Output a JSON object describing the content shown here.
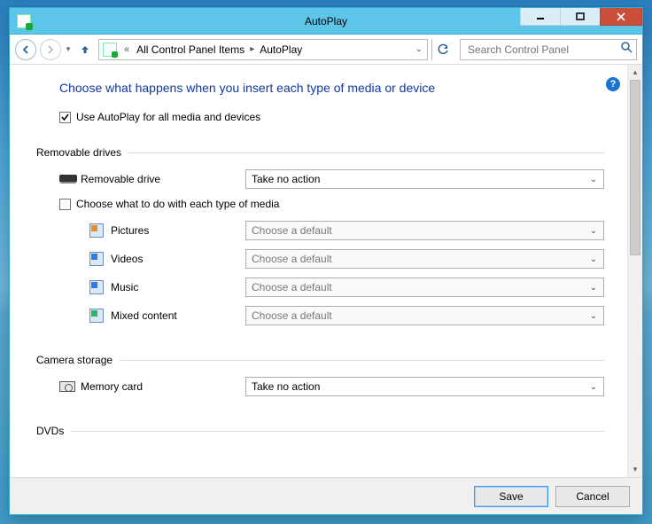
{
  "window": {
    "title": "AutoPlay"
  },
  "nav": {
    "breadcrumb_root": "All Control Panel Items",
    "breadcrumb_leaf": "AutoPlay",
    "search_placeholder": "Search Control Panel"
  },
  "page": {
    "heading": "Choose what happens when you insert each type of media or device",
    "global_checkbox_label": "Use AutoPlay for all media and devices",
    "global_checkbox_checked": true,
    "help_tooltip": "?"
  },
  "sections": {
    "removable": {
      "title": "Removable drives",
      "drive_label": "Removable drive",
      "drive_value": "Take no action",
      "per_media_checkbox_label": "Choose what to do with each type of media",
      "per_media_checked": false,
      "media": [
        {
          "label": "Pictures",
          "value": "Choose a default",
          "icon_color": "#e78b2f"
        },
        {
          "label": "Videos",
          "value": "Choose a default",
          "icon_color": "#2f7be7"
        },
        {
          "label": "Music",
          "value": "Choose a default",
          "icon_color": "#2f7be7"
        },
        {
          "label": "Mixed content",
          "value": "Choose a default",
          "icon_color": "#2fb36a"
        }
      ]
    },
    "camera": {
      "title": "Camera storage",
      "item_label": "Memory card",
      "item_value": "Take no action"
    },
    "dvds": {
      "title": "DVDs"
    }
  },
  "footer": {
    "save": "Save",
    "cancel": "Cancel"
  }
}
